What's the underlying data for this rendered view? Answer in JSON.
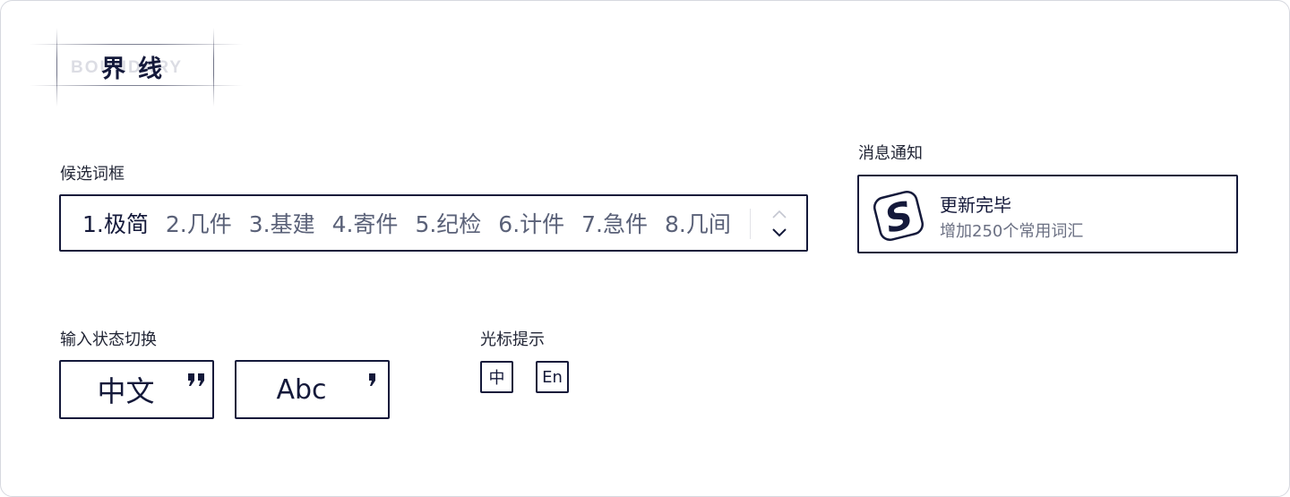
{
  "brand": {
    "title": "界线",
    "watermark": "BOUNDARY"
  },
  "candidate_box": {
    "label": "候选词框",
    "candidates": [
      "1.极简",
      "2.几件",
      "3.基建",
      "4.寄件",
      "5.纪检",
      "6.计件",
      "7.急件",
      "8.几间"
    ],
    "active_index": 0,
    "pager_icons": [
      "chevron-up-icon",
      "chevron-down-icon"
    ]
  },
  "notification": {
    "label": "消息通知",
    "title": "更新完毕",
    "message": "增加250个常用词汇",
    "logo_letter": "S"
  },
  "input_mode": {
    "label": "输入状态切换",
    "chinese": "中文",
    "english": "Abc"
  },
  "cursor_hint": {
    "label": "光标提示",
    "chinese": "中",
    "english": "En"
  },
  "colors": {
    "ink": "#14193a",
    "muted": "#5a6178",
    "border": "#d6d8df"
  }
}
